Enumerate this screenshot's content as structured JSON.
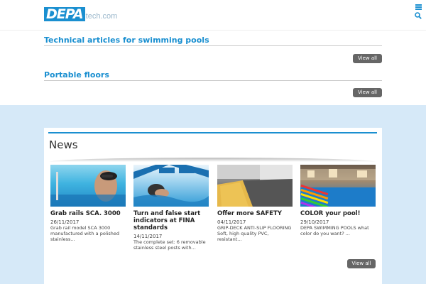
{
  "header": {
    "logo_mark": "DEPA",
    "logo_sub": "tech.com"
  },
  "sections": [
    {
      "title": "Technical articles for swimming pools",
      "view_all": "View all"
    },
    {
      "title": "Portable floors",
      "view_all": "View all"
    }
  ],
  "news": {
    "title": "News",
    "view_all": "View all",
    "items": [
      {
        "title": "Grab rails SCA. 3000",
        "date": "26/11/2017",
        "text": "Grab rail model SCA 3000 manufactured with a polished stainless..."
      },
      {
        "title": "Turn and false start indicators at FINA standards",
        "date": "14/11/2017",
        "text": "The complete set:  6 removable stainless steel posts with..."
      },
      {
        "title": "Offer more SAFETY",
        "date": "04/11/2017",
        "text": "GRIP-DECK ANTI-SLIP FLOORING Soft, high quality PVC, resistant..."
      },
      {
        "title": "COLOR your pool!",
        "date": "29/10/2017",
        "text": "DEPA SWIMMING POOLS what color do you want?  ..."
      }
    ]
  },
  "colors": {
    "accent": "#1a8fd0",
    "band": "#d6e9f8",
    "button": "#666666"
  }
}
